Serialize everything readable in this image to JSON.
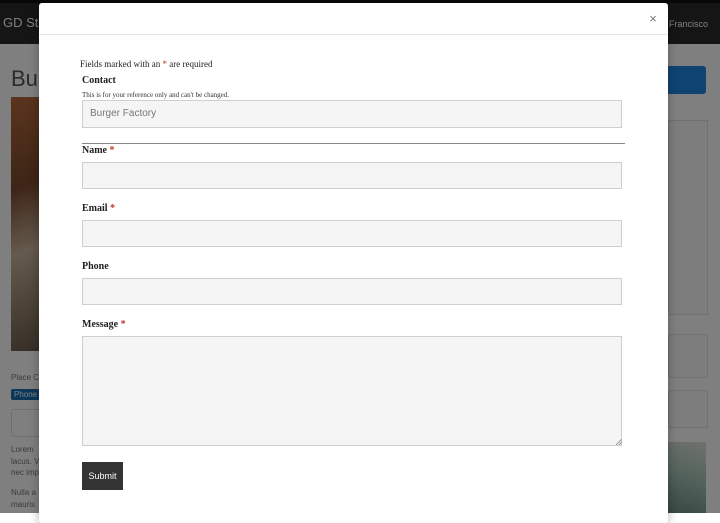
{
  "background": {
    "brand": "GD Star",
    "city": "Francisco",
    "title": "Bur",
    "place": "Place C",
    "badge": "Phone",
    "home": "P",
    "lorem1": "Lorem",
    "lorem2": "lacus. V",
    "lorem3": "nec imp",
    "lorem4": "Nulla a",
    "lorem5": "mauris"
  },
  "modal": {
    "close_symbol": "×",
    "required_note_prefix": "Fields marked with an",
    "required_star": "*",
    "required_note_suffix": "are required",
    "contact": {
      "label": "Contact",
      "help": "This is for your reference only and can't be changed.",
      "value": "Burger Factory"
    },
    "name": {
      "label": "Name",
      "star": "*",
      "value": ""
    },
    "email": {
      "label": "Email",
      "star": "*",
      "value": ""
    },
    "phone": {
      "label": "Phone",
      "value": ""
    },
    "message": {
      "label": "Message",
      "star": "*",
      "value": ""
    },
    "submit_label": "Submit"
  }
}
